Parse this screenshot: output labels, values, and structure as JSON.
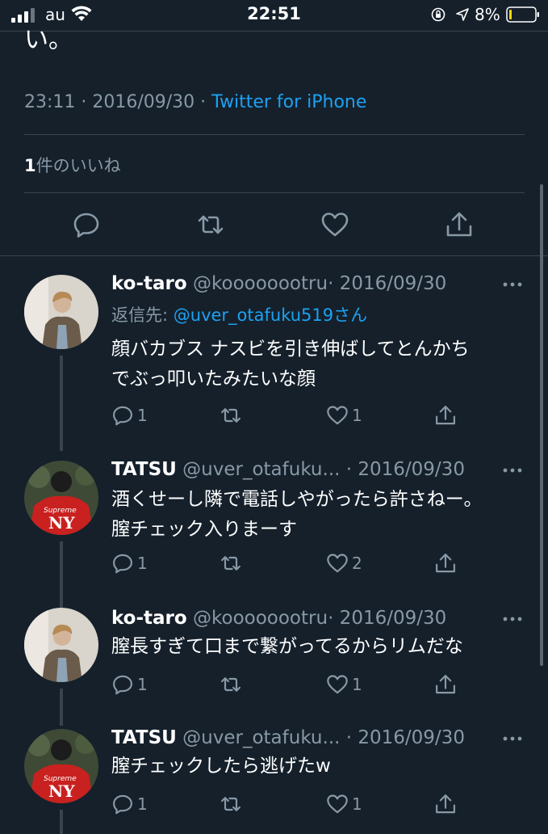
{
  "status_bar": {
    "carrier": "au",
    "time": "22:51",
    "battery": "8%"
  },
  "main_tweet": {
    "cut_text": "い。",
    "timestamp": "23:11 · 2016/09/30 · ",
    "source": "Twitter for iPhone",
    "likes_count": "1",
    "likes_label": "件のいいね"
  },
  "replies": [
    {
      "name": "ko-taro",
      "handle": "@koooooootru",
      "date": "· 2016/09/30",
      "reply_prefix": "返信先: ",
      "reply_to": "@uver_otafuku519さん",
      "lines": [
        "顔バカブス ナスビを引き伸ばしてとんかち",
        "でぶっ叩いたみたいな顔"
      ],
      "reply_count": "1",
      "like_count": "1"
    },
    {
      "name": "TATSU",
      "handle": "@uver_otafuku...",
      "date": "· 2016/09/30",
      "lines": [
        "酒くせーし隣で電話しやがったら許さねー。",
        "膣チェック入りまーす"
      ],
      "reply_count": "1",
      "like_count": "2"
    },
    {
      "name": "ko-taro",
      "handle": "@koooooootru",
      "date": "· 2016/09/30",
      "lines": [
        "膣長すぎて口まで繋がってるからリムだな"
      ],
      "reply_count": "1",
      "like_count": "1"
    },
    {
      "name": "TATSU",
      "handle": "@uver_otafuku...",
      "date": "· 2016/09/30",
      "lines": [
        "膣チェックしたら逃げたw"
      ],
      "reply_count": "1",
      "like_count": "1"
    }
  ],
  "colors": {
    "background": "#15202b",
    "accent": "#1da1f2",
    "secondary_text": "#8899a6",
    "divider": "#38444d"
  }
}
